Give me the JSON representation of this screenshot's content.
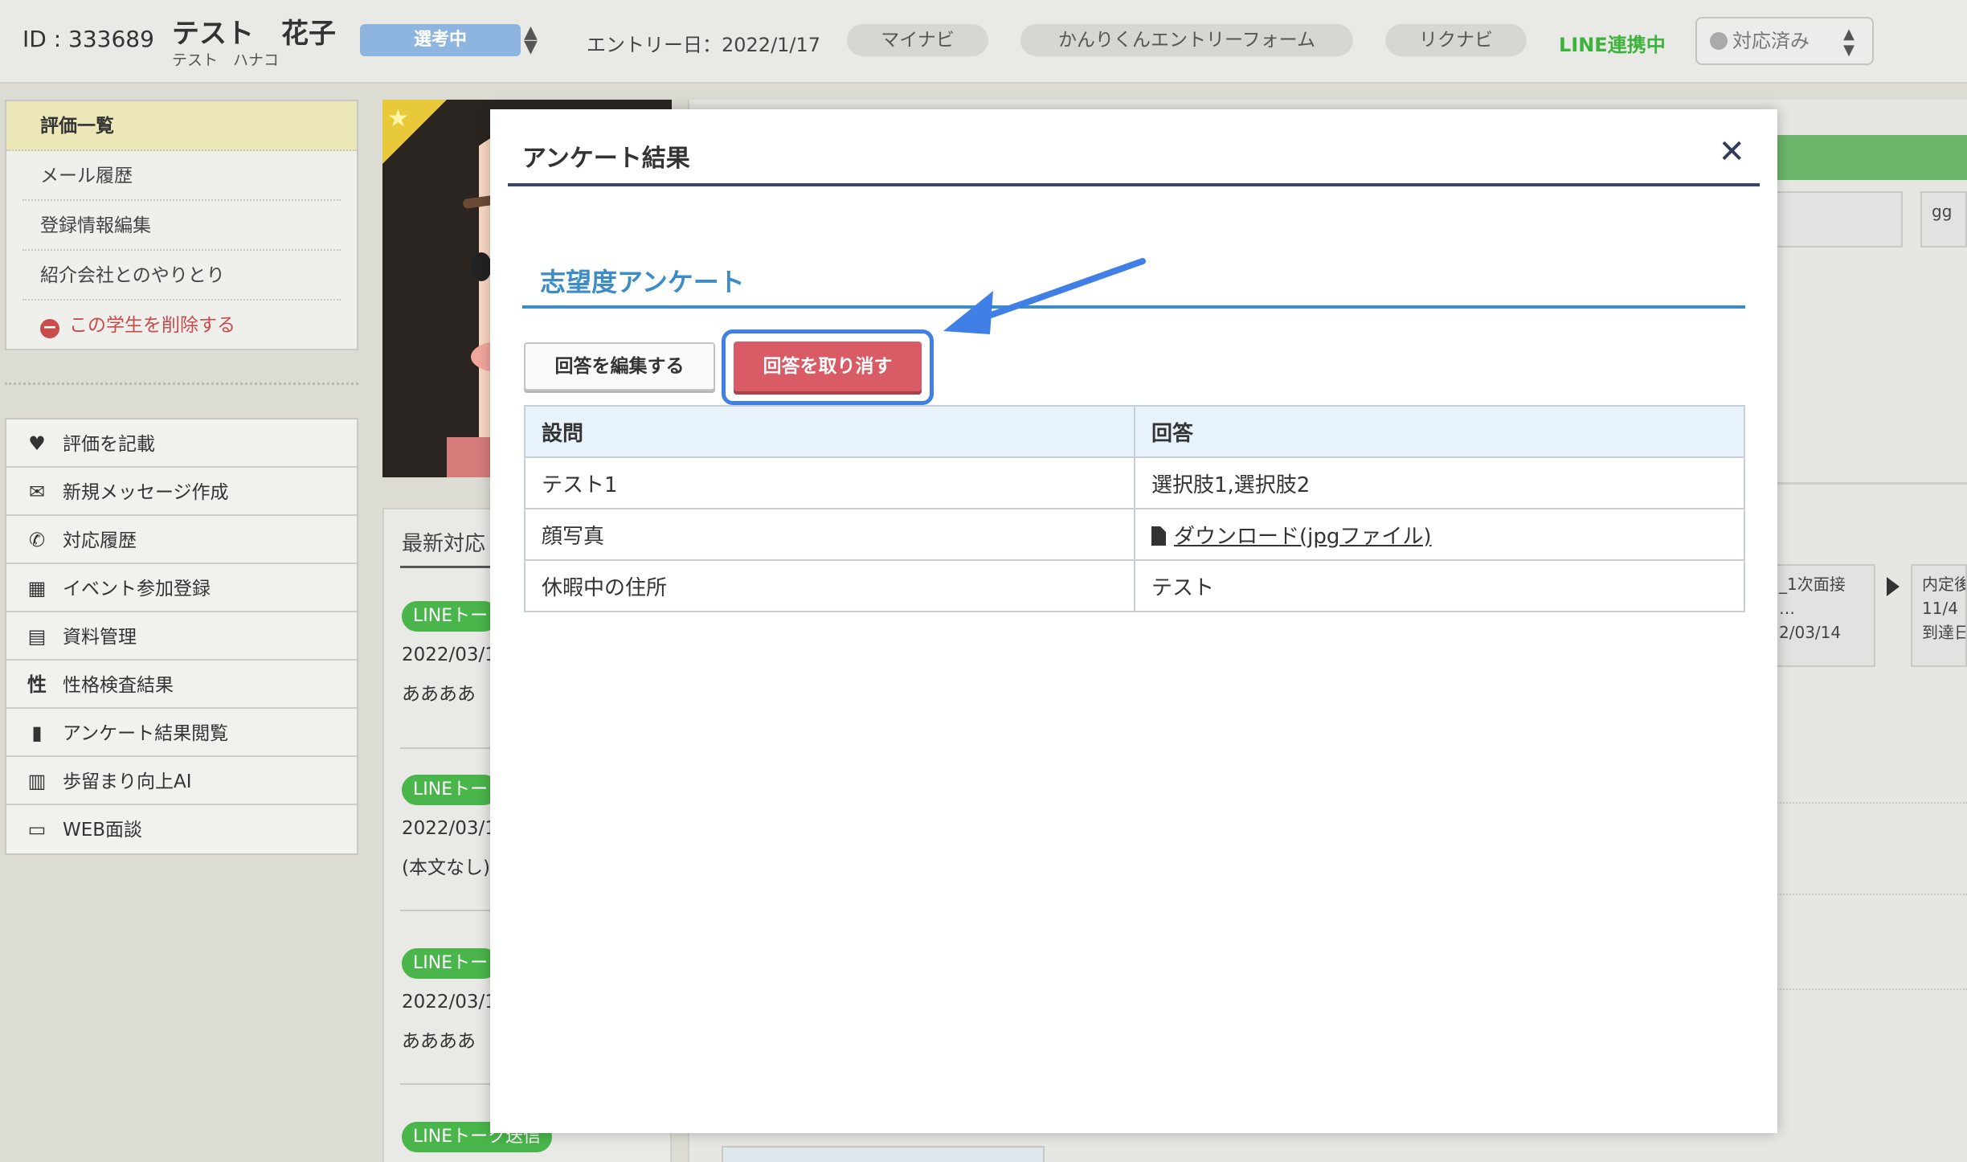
{
  "header": {
    "id_label": "ID : 333689",
    "name": "テスト　花子",
    "kana": "テスト　ハナコ",
    "status": "選考中",
    "entry_date": "エントリー日：2022/1/17",
    "sources": [
      "マイナビ",
      "かんりくんエントリーフォーム",
      "リクナビ"
    ],
    "line_status": "LINE連携中",
    "response_select": "対応済み"
  },
  "sidebar": {
    "menu1": [
      {
        "label": "評価一覧"
      },
      {
        "label": "メール履歴"
      },
      {
        "label": "登録情報編集"
      },
      {
        "label": "紹介会社とのやりとり"
      },
      {
        "label": "この学生を削除する"
      }
    ],
    "menu2": [
      {
        "label": "評価を記載",
        "icon": "heart-icon"
      },
      {
        "label": "新規メッセージ作成",
        "icon": "envelope-icon"
      },
      {
        "label": "対応履歴",
        "icon": "phone-icon"
      },
      {
        "label": "イベント参加登録",
        "icon": "calendar-icon"
      },
      {
        "label": "資料管理",
        "icon": "document-icon"
      },
      {
        "label": "性格検査結果",
        "icon": "personality-icon"
      },
      {
        "label": "アンケート結果閲覧",
        "icon": "bar-chart-icon"
      },
      {
        "label": "歩留まり向上AI",
        "icon": "ai-report-icon"
      },
      {
        "label": "WEB面談",
        "icon": "monitor-icon"
      }
    ]
  },
  "latest": {
    "title": "最新対応",
    "logs": [
      {
        "badge": "LINEトー",
        "date": "2022/03/1",
        "body": "ああああ"
      },
      {
        "badge": "LINEトー",
        "date": "2022/03/1",
        "body": "(本文なし)"
      },
      {
        "badge": "LINEトー",
        "date": "2022/03/1",
        "body": "ああああ"
      },
      {
        "badge": "LINEトーク送信"
      }
    ]
  },
  "background": {
    "box_gg": "gg",
    "flow1_line1": "_1次面接",
    "flow1_line2": "…",
    "flow1_line3": "2/03/14",
    "flow2_line1": "内定後",
    "flow2_line2": "11/4",
    "flow2_line3": "到達日"
  },
  "modal": {
    "title": "アンケート結果",
    "section_title": "志望度アンケート",
    "edit_button": "回答を編集する",
    "cancel_button": "回答を取り消す",
    "table": {
      "headers": [
        "設問",
        "回答"
      ],
      "rows": [
        {
          "question": "テスト1",
          "answer": "選択肢1,選択肢2"
        },
        {
          "question": "顔写真",
          "answer": "ダウンロード(jpgファイル)"
        },
        {
          "question": "休暇中の住所",
          "answer": "テスト"
        }
      ]
    }
  },
  "colors": {
    "accent_blue": "#3e8cc6",
    "danger_red": "#d95b66",
    "annotation_blue": "#3f7fe6",
    "line_green": "#3db23d"
  }
}
